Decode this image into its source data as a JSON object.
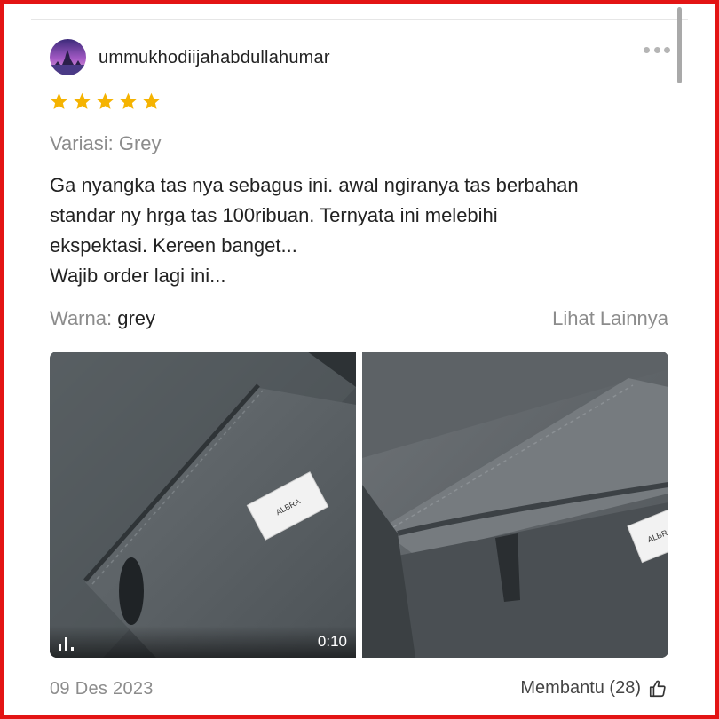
{
  "review": {
    "username": "ummukhodiijahabdullahumar",
    "rating": 5,
    "rating_max": 5,
    "variant": "Variasi: Grey",
    "text_lines": [
      "Ga nyangka tas nya sebagus ini. awal ngiranya tas berbahan",
      "standar ny hrga tas 100ribuan. Ternyata ini melebihi",
      "ekspektasi. Kereen banget...",
      "Wajib order lagi ini..."
    ],
    "color_label": "Warna:",
    "color_value": "grey",
    "see_more": "Lihat Lainnya",
    "media": [
      {
        "type": "video",
        "duration": "0:10",
        "label_text": "ALBRA"
      },
      {
        "type": "photo",
        "label_text": "ALBRA"
      }
    ],
    "date": "09 Des 2023",
    "helpful_label": "Membantu (28)"
  },
  "icons": {
    "star": "star-icon",
    "more": "more-dots-icon",
    "video": "video-indicator-icon",
    "helpful": "thumbs-up-icon"
  },
  "colors": {
    "star": "#f5b301",
    "frame": "#e31414",
    "muted_text": "#8c8c8c",
    "body_text": "#222222"
  }
}
